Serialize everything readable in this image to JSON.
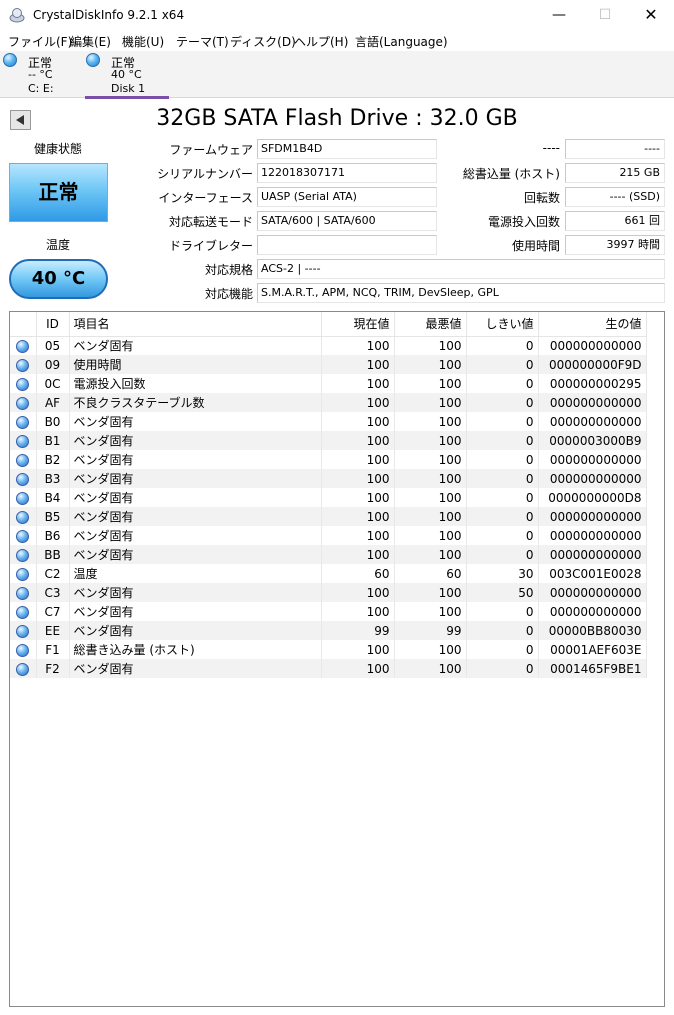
{
  "window": {
    "title": "CrystalDiskInfo 9.2.1 x64",
    "min": "—",
    "max": "☐",
    "close": "✕"
  },
  "menu": [
    "ファイル(F)",
    "編集(E)",
    "機能(U)",
    "テーマ(T)",
    "ディスク(D)",
    "ヘルプ(H)",
    "言語(Language)"
  ],
  "tabs": [
    {
      "status": "正常",
      "temp": "-- °C",
      "name": "C: E:"
    },
    {
      "status": "正常",
      "temp": "40 °C",
      "name": "Disk 1"
    }
  ],
  "drive": {
    "model": "32GB SATA Flash Drive : 32.0 GB",
    "health_label": "健康状態",
    "health_value": "正常",
    "temp_label": "温度",
    "temp_value": "40 °C",
    "fields": {
      "firmware": {
        "label": "ファームウェア",
        "value": "SFDM1B4D"
      },
      "serial": {
        "label": "シリアルナンバー",
        "value": "122018307171"
      },
      "interface": {
        "label": "インターフェース",
        "value": "UASP (Serial ATA)"
      },
      "transfer": {
        "label": "対応転送モード",
        "value": "SATA/600 | SATA/600"
      },
      "drive_letter": {
        "label": "ドライブレター",
        "value": ""
      },
      "standard": {
        "label": "対応規格",
        "value": "ACS-2 | ----"
      },
      "features": {
        "label": "対応機能",
        "value": "S.M.A.R.T., APM, NCQ, TRIM, DevSleep, GPL"
      },
      "top_right": {
        "label": "----",
        "value": "----"
      },
      "host_writes": {
        "label": "総書込量 (ホスト)",
        "value": "215 GB"
      },
      "rotation": {
        "label": "回転数",
        "value": "---- (SSD)"
      },
      "power_count": {
        "label": "電源投入回数",
        "value": "661 回"
      },
      "power_hours": {
        "label": "使用時間",
        "value": "3997 時間"
      }
    }
  },
  "smart": {
    "headers": {
      "id": "ID",
      "name": "項目名",
      "current": "現在値",
      "worst": "最悪値",
      "threshold": "しきい値",
      "raw": "生の値"
    },
    "rows": [
      {
        "id": "05",
        "name": "ベンダ固有",
        "current": "100",
        "worst": "100",
        "threshold": "0",
        "raw": "000000000000"
      },
      {
        "id": "09",
        "name": "使用時間",
        "current": "100",
        "worst": "100",
        "threshold": "0",
        "raw": "000000000F9D"
      },
      {
        "id": "0C",
        "name": "電源投入回数",
        "current": "100",
        "worst": "100",
        "threshold": "0",
        "raw": "000000000295"
      },
      {
        "id": "AF",
        "name": "不良クラスタテーブル数",
        "current": "100",
        "worst": "100",
        "threshold": "0",
        "raw": "000000000000"
      },
      {
        "id": "B0",
        "name": "ベンダ固有",
        "current": "100",
        "worst": "100",
        "threshold": "0",
        "raw": "000000000000"
      },
      {
        "id": "B1",
        "name": "ベンダ固有",
        "current": "100",
        "worst": "100",
        "threshold": "0",
        "raw": "0000003000B9"
      },
      {
        "id": "B2",
        "name": "ベンダ固有",
        "current": "100",
        "worst": "100",
        "threshold": "0",
        "raw": "000000000000"
      },
      {
        "id": "B3",
        "name": "ベンダ固有",
        "current": "100",
        "worst": "100",
        "threshold": "0",
        "raw": "000000000000"
      },
      {
        "id": "B4",
        "name": "ベンダ固有",
        "current": "100",
        "worst": "100",
        "threshold": "0",
        "raw": "0000000000D8"
      },
      {
        "id": "B5",
        "name": "ベンダ固有",
        "current": "100",
        "worst": "100",
        "threshold": "0",
        "raw": "000000000000"
      },
      {
        "id": "B6",
        "name": "ベンダ固有",
        "current": "100",
        "worst": "100",
        "threshold": "0",
        "raw": "000000000000"
      },
      {
        "id": "BB",
        "name": "ベンダ固有",
        "current": "100",
        "worst": "100",
        "threshold": "0",
        "raw": "000000000000"
      },
      {
        "id": "C2",
        "name": "温度",
        "current": "60",
        "worst": "60",
        "threshold": "30",
        "raw": "003C001E0028"
      },
      {
        "id": "C3",
        "name": "ベンダ固有",
        "current": "100",
        "worst": "100",
        "threshold": "50",
        "raw": "000000000000"
      },
      {
        "id": "C7",
        "name": "ベンダ固有",
        "current": "100",
        "worst": "100",
        "threshold": "0",
        "raw": "000000000000"
      },
      {
        "id": "EE",
        "name": "ベンダ固有",
        "current": "99",
        "worst": "99",
        "threshold": "0",
        "raw": "00000BB80030"
      },
      {
        "id": "F1",
        "name": "総書き込み量 (ホスト)",
        "current": "100",
        "worst": "100",
        "threshold": "0",
        "raw": "00001AEF603E"
      },
      {
        "id": "F2",
        "name": "ベンダ固有",
        "current": "100",
        "worst": "100",
        "threshold": "0",
        "raw": "0001465F9BE1"
      }
    ]
  }
}
